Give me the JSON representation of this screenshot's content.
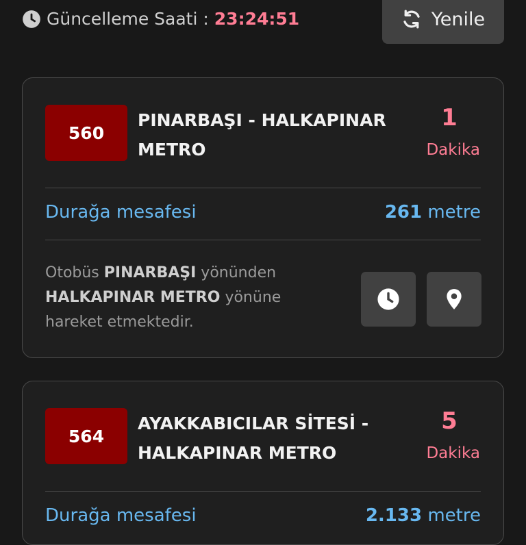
{
  "header": {
    "update_label": "Güncelleme Saati :",
    "update_time": "23:24:51",
    "refresh_label": "Yenile"
  },
  "cards": [
    {
      "route_number": "560",
      "route_name": "PINARBAŞI - HALKAPINAR METRO",
      "eta_value": "1",
      "eta_unit": "Dakika",
      "distance_label": "Durağa mesafesi",
      "distance_value": "261",
      "distance_unit": "metre",
      "direction": {
        "prefix": "Otobüs",
        "from": "PINARBAŞI",
        "middle": "yönünden",
        "to": "HALKAPINAR METRO",
        "suffix": "yönüne hareket etmektedir."
      }
    },
    {
      "route_number": "564",
      "route_name": "AYAKKABICILAR SİTESİ - HALKAPINAR METRO",
      "eta_value": "5",
      "eta_unit": "Dakika",
      "distance_label": "Durağa mesafesi",
      "distance_value": "2.133",
      "distance_unit": "metre"
    }
  ],
  "colors": {
    "background": "#181818",
    "card": "#1f1f1f",
    "accent_pink": "#ff7d94",
    "accent_blue": "#68b8f0",
    "route_badge": "#8b0000",
    "button": "#414141"
  },
  "icons": {
    "header_icon": "clock-icon",
    "refresh_icon": "refresh-icon",
    "schedule_icon": "clock-icon",
    "location_icon": "map-pin-icon"
  }
}
